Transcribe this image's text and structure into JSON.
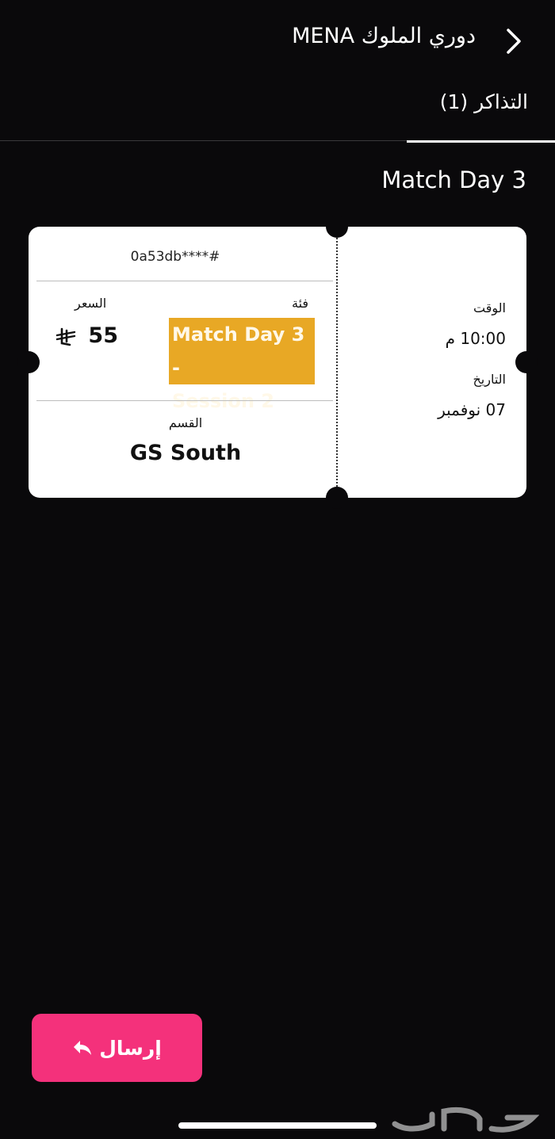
{
  "header": {
    "title": "دوري الملوك MENA",
    "back_icon": "chevron-right-icon"
  },
  "tabs": [
    {
      "label": "التذاكر (1)",
      "active": true
    }
  ],
  "event": {
    "title": "Match Day 3"
  },
  "ticket": {
    "code": "0a53db****#",
    "price_label": "السعر",
    "price_value": "55",
    "currency_icon": "saudi-riyal-icon",
    "category_label": "فئة",
    "category_value_line1": "Match Day 3 -",
    "category_value_line2": "Session 2",
    "section_label": "القسم",
    "section_value": "GS South",
    "time_label": "الوقت",
    "time_value": "10:00 م",
    "date_label": "التاريخ",
    "date_value": "07 نوفمبر"
  },
  "actions": {
    "send_label": "إرسال",
    "send_icon": "reply-arrow-icon"
  },
  "colors": {
    "background": "#0a090b",
    "accent": "#f4317b",
    "highlight": "#e8a825"
  }
}
